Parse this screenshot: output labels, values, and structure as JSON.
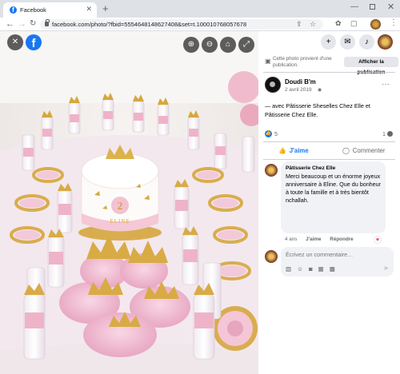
{
  "browser": {
    "tab_title": "Facebook",
    "tab_favicon": "f",
    "url": "facebook.com/photo/?fbid=5554648148627408&set=t.100010768057678"
  },
  "viewer": {
    "close_icon": "close-icon",
    "logo_letter": "f",
    "zoom_in_icon": "zoom-in-icon",
    "zoom_out_icon": "zoom-out-icon",
    "tag_icon": "tag-icon",
    "fullscreen_icon": "fullscreen-icon",
    "cake_number": "2",
    "cake_topper": "ELINE"
  },
  "notice": {
    "text": "Cette photo provient d'une publication.",
    "button_label": "Afficher la publication"
  },
  "post": {
    "author": "Doudi B'm",
    "date": "2 avril 2019",
    "text": "— avec Pâtisserie Sheselles Chez Elle et Pâtisserie Chez Elle.",
    "like_count": "5",
    "comment_count": "1"
  },
  "actions": {
    "like_label": "J'aime",
    "comment_label": "Commenter"
  },
  "comment": {
    "author": "Pâtisserie Chez Elle",
    "text": "Merci beaucoup et un énorme joyeux anniversaire à Eline. Que du bonheur à toute la famille et à très bientôt nchallah.",
    "age": "4 ans",
    "like_label": "J'aime",
    "reply_label": "Répondre"
  },
  "write_comment": {
    "placeholder": "Écrivez un commentaire…"
  },
  "colors": {
    "facebook_blue": "#1877f2",
    "heart_red": "#f33e58",
    "secondary_text": "#65676b"
  }
}
